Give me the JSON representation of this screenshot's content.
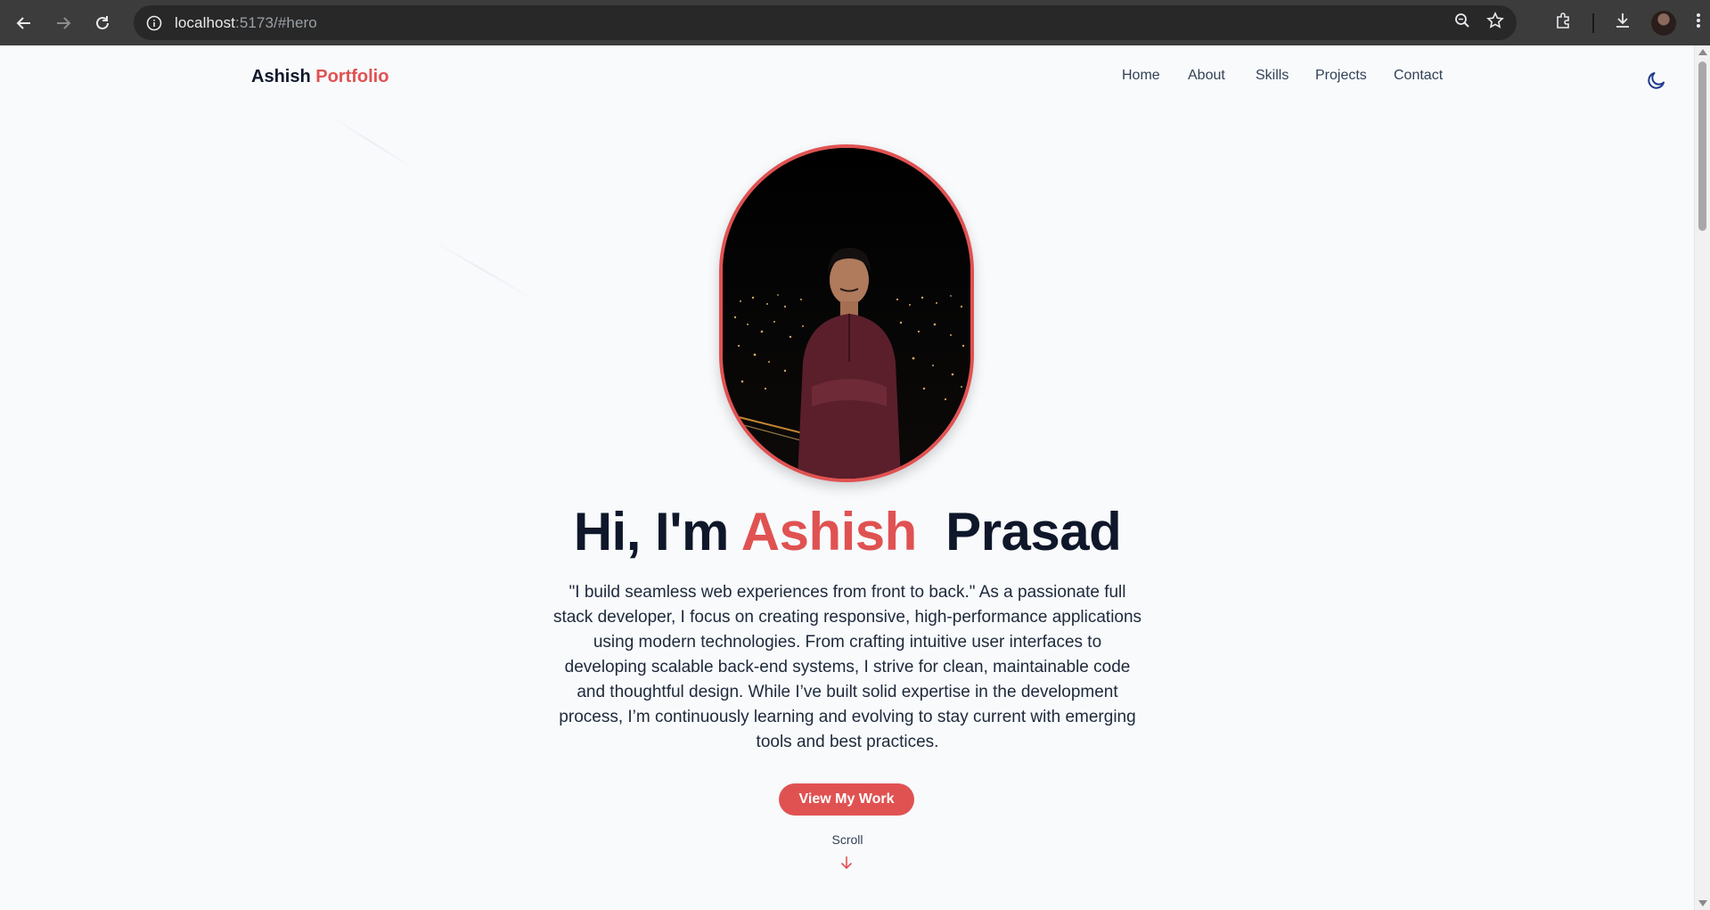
{
  "browser": {
    "url_host": "localhost",
    "url_rest": ":5173/#hero"
  },
  "site": {
    "logo_primary": "Ashish",
    "logo_accent": "Portfolio",
    "nav": [
      "Home",
      "About",
      "Skills",
      "Projects",
      "Contact"
    ]
  },
  "hero": {
    "greeting": "Hi, I'm",
    "first_name": "Ashish",
    "last_name": "Prasad",
    "description": "\"I build seamless web experiences from front to back.\" As a passionate full stack developer, I focus on creating responsive, high-performance applications using modern technologies. From crafting intuitive user interfaces to developing scalable back-end systems, I strive for clean, maintainable code and thoughtful design. While I’ve built solid expertise in the development process, I’m continuously learning and evolving to stay current with emerging tools and best practices.",
    "cta_label": "View My Work",
    "scroll_label": "Scroll"
  },
  "colors": {
    "accent": "#e05252",
    "text_dark": "#0f172a",
    "background": "#f8fafc",
    "toggle_icon": "#1e3a8a"
  },
  "icons": [
    "back-arrow-icon",
    "forward-arrow-icon",
    "reload-icon",
    "site-info-icon",
    "zoom-icon",
    "bookmark-star-icon",
    "extensions-icon",
    "download-icon",
    "menu-dots-icon",
    "moon-icon",
    "arrow-down-icon"
  ]
}
